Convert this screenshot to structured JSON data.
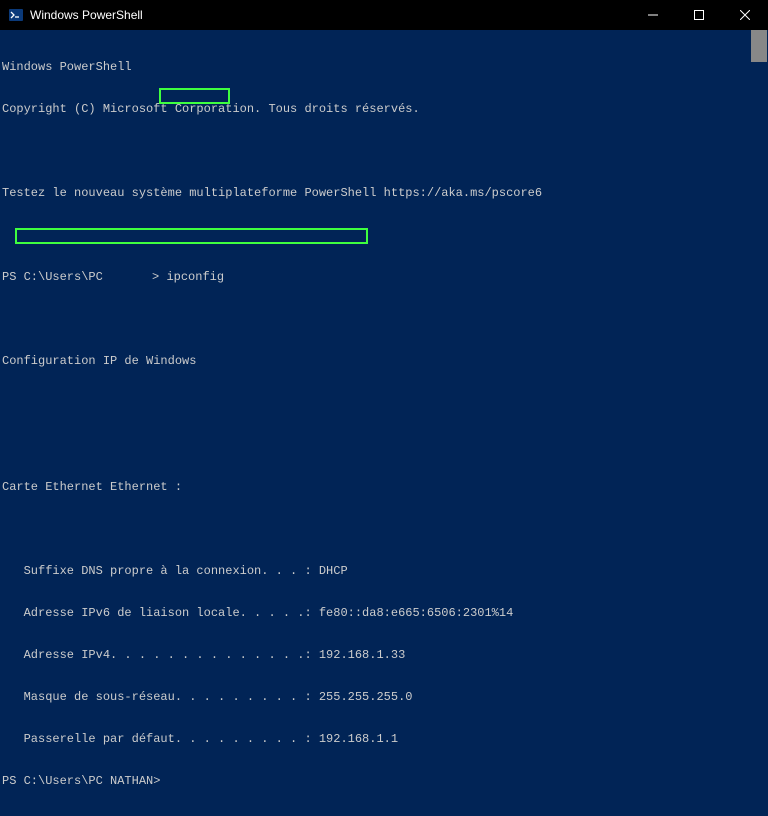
{
  "titlebar": {
    "title": "Windows PowerShell"
  },
  "terminal": {
    "line1": "Windows PowerShell",
    "line2": "Copyright (C) Microsoft Corporation. Tous droits réservés.",
    "line3": "Testez le nouveau système multiplateforme PowerShell https://aka.ms/pscore6",
    "prompt1_prefix": "PS C:\\Users\\PC ",
    "prompt1_suffix": "> ",
    "command1": "ipconfig",
    "config_header": "Configuration IP de Windows",
    "adapter_header": "Carte Ethernet Ethernet :",
    "dns_suffix": "   Suffixe DNS propre à la connexion. . . : DHCP",
    "ipv6": "   Adresse IPv6 de liaison locale. . . . .: fe80::da8:e665:6506:2301%14",
    "ipv4": "   Adresse IPv4. . . . . . . . . . . . . .: 192.168.1.33",
    "subnet": "   Masque de sous-réseau. . . . . . . . . : 255.255.255.0",
    "gateway": "   Passerelle par défaut. . . . . . . . . : 192.168.1.1",
    "prompt2": "PS C:\\Users\\PC NATHAN>"
  }
}
